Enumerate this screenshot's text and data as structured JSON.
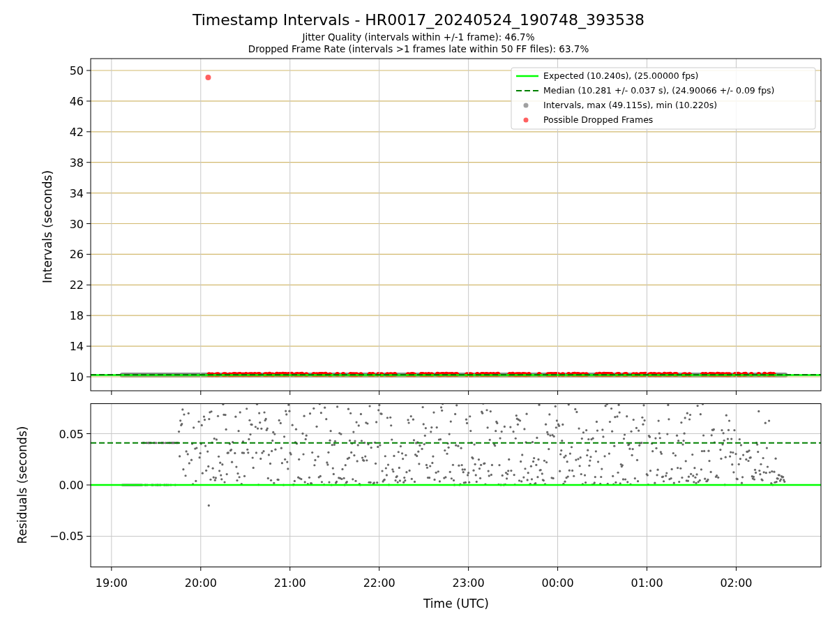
{
  "figure": {
    "title": "Timestamp Intervals - HR0017_20240524_190748_393538",
    "subtitles": [
      "Jitter Quality (intervals within +/-1 frame): 46.7%",
      "Dropped Frame Rate (intervals >1 frames late within 50 FF files): 63.7%"
    ]
  },
  "top_chart": {
    "chart_data": {
      "type": "scatter",
      "ylabel": "Intervals (seconds)",
      "xlim": [
        "2024-05-24T18:46",
        "2024-05-25T02:57"
      ],
      "ylim": [
        8.18,
        51.55
      ],
      "yticks": [
        {
          "value": 10,
          "label": "10"
        },
        {
          "value": 14,
          "label": "14"
        },
        {
          "value": 18,
          "label": "18"
        },
        {
          "value": 22,
          "label": "22"
        },
        {
          "value": 26,
          "label": "26"
        },
        {
          "value": 30,
          "label": "30"
        },
        {
          "value": 34,
          "label": "34"
        },
        {
          "value": 38,
          "label": "38"
        },
        {
          "value": 42,
          "label": "42"
        },
        {
          "value": 46,
          "label": "46"
        },
        {
          "value": 50,
          "label": "50"
        }
      ],
      "ref_lines": [
        {
          "axis": "y",
          "value": 10.24,
          "label": "Expected (10.240s), (25.00000 fps)",
          "color": "#00ff00"
        },
        {
          "axis": "y",
          "value": 10.28,
          "label": "Median (10.281 +/- 0.037 s), (24.90066 +/- 0.09 fps)",
          "color": "#008000"
        }
      ],
      "grid": true,
      "legend": "upper right",
      "series": [
        {
          "name": "Intervals, max (49.115s), min (10.220s)",
          "color": "#a0a0a0"
        },
        {
          "name": "Possible Dropped Frames",
          "color": "#ff6060",
          "x": [
            "2024-05-24T20:05"
          ],
          "values": [
            49.1
          ]
        }
      ]
    }
  },
  "bottom_chart": {
    "chart_data": {
      "type": "scatter",
      "xlabel": "Time (UTC)",
      "ylabel": "Residuals (seconds)",
      "xlim": [
        "2024-05-24T18:46",
        "2024-05-25T02:57"
      ],
      "ylim": [
        -0.0796,
        0.0796
      ],
      "xticks": [
        {
          "value": "2024-05-24T19:00",
          "label": "19:00"
        },
        {
          "value": "2024-05-24T20:00",
          "label": "20:00"
        },
        {
          "value": "2024-05-24T21:00",
          "label": "21:00"
        },
        {
          "value": "2024-05-24T22:00",
          "label": "22:00"
        },
        {
          "value": "2024-05-24T23:00",
          "label": "23:00"
        },
        {
          "value": "2024-05-25T00:00",
          "label": "00:00"
        },
        {
          "value": "2024-05-25T01:00",
          "label": "01:00"
        },
        {
          "value": "2024-05-25T02:00",
          "label": "02:00"
        }
      ],
      "yticks": [
        {
          "value": 0.05,
          "label": "0.05"
        },
        {
          "value": 0,
          "label": "0.00"
        },
        {
          "value": -0.05,
          "label": "−0.05"
        }
      ],
      "ref_lines": [
        {
          "axis": "y",
          "value": 0,
          "color": "#00ff00"
        },
        {
          "axis": "y",
          "value": 0.041,
          "color": "#008000"
        }
      ],
      "grid": true
    }
  }
}
